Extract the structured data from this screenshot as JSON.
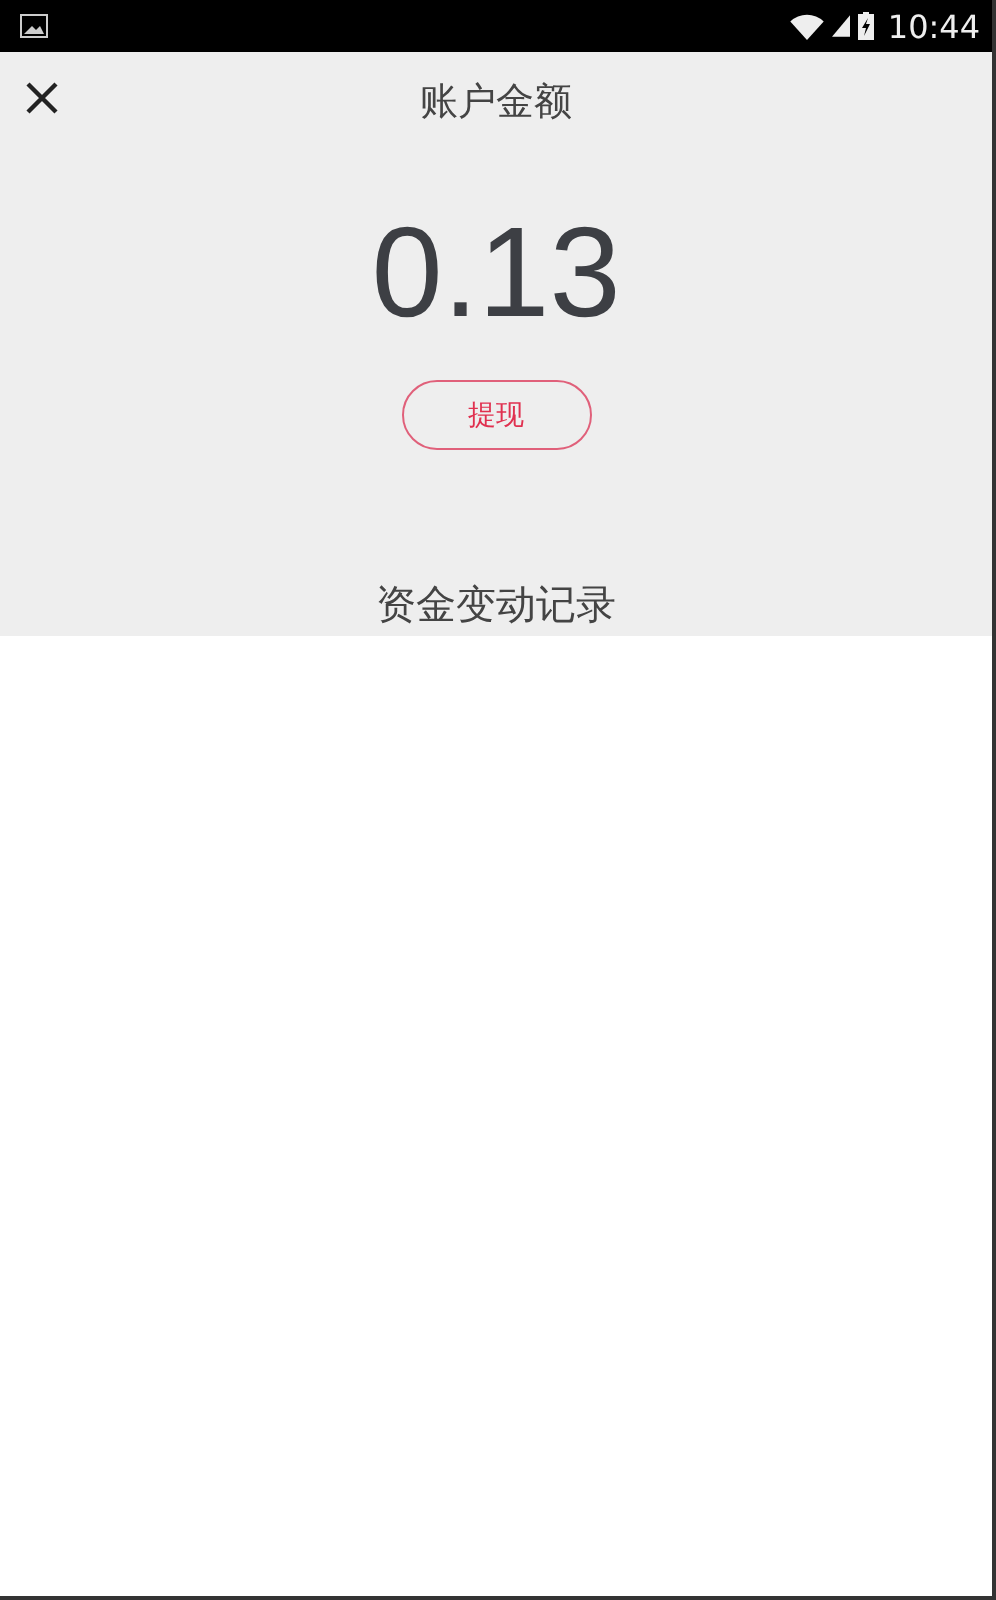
{
  "status_bar": {
    "time": "10:44"
  },
  "header": {
    "title": "账户金额"
  },
  "balance": {
    "amount": "0.13",
    "withdraw_button": "提现"
  },
  "records": {
    "title": "资金变动记录"
  }
}
